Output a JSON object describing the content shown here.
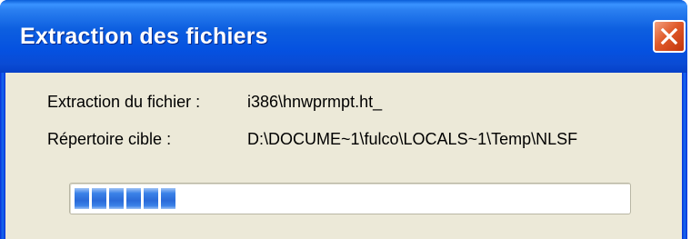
{
  "window": {
    "title": "Extraction des fichiers",
    "close_icon": "close-icon",
    "accent": "#0831d9",
    "close_color": "#e05a2a"
  },
  "fields": [
    {
      "label": "Extraction du fichier :",
      "value": "i386\\hnwprmpt.ht_"
    },
    {
      "label": "Répertoire cible :",
      "value": "D:\\DOCUME~1\\fulco\\LOCALS~1\\Temp\\NLSF"
    }
  ],
  "progress": {
    "fraction": 0.22,
    "block_count": 6,
    "color": "#2a6ad8"
  }
}
